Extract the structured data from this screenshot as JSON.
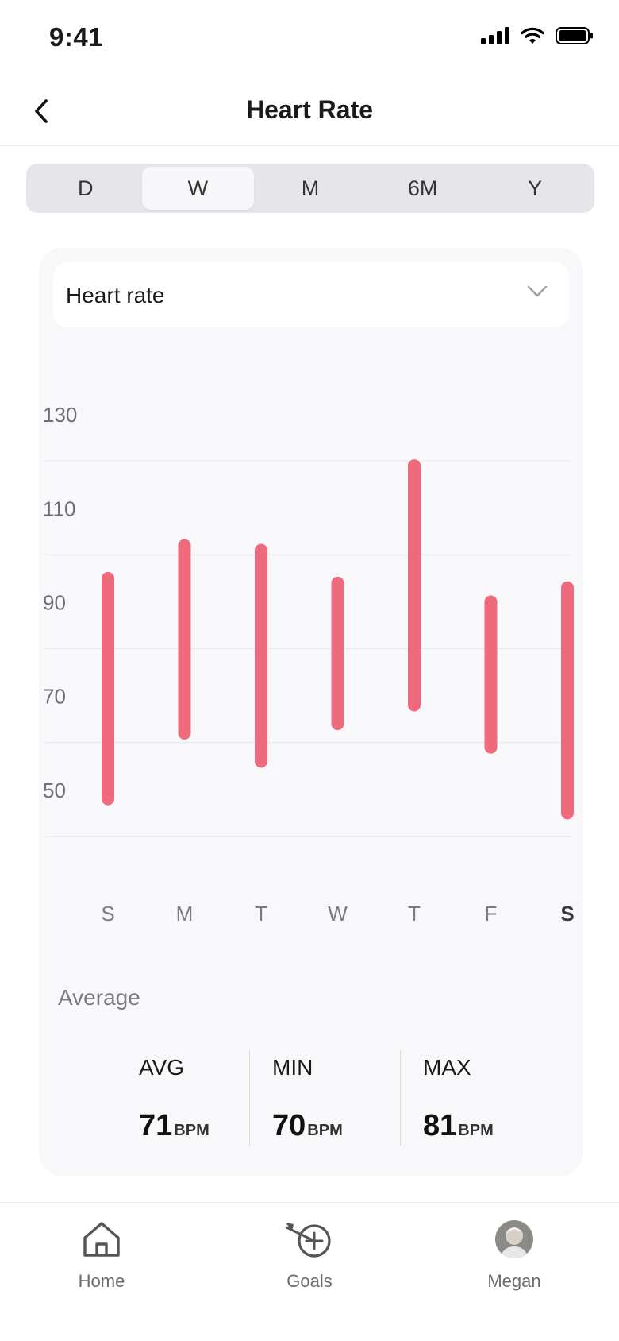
{
  "status_bar": {
    "time": "9:41"
  },
  "nav": {
    "title": "Heart Rate"
  },
  "segments": [
    {
      "label": "D",
      "active": false
    },
    {
      "label": "W",
      "active": true
    },
    {
      "label": "M",
      "active": false
    },
    {
      "label": "6M",
      "active": false
    },
    {
      "label": "Y",
      "active": false
    }
  ],
  "metric_selector": {
    "label": "Heart rate"
  },
  "chart_data": {
    "type": "bar",
    "subtype": "range",
    "categories": [
      "S",
      "M",
      "T",
      "W",
      "T",
      "F",
      "S"
    ],
    "highlighted_category_index": 6,
    "series": [
      {
        "low": [
          48,
          62,
          56,
          64,
          68,
          59,
          45
        ],
        "high": [
          95,
          102,
          101,
          94,
          119,
          90,
          93
        ]
      }
    ],
    "y_ticks": [
      50,
      70,
      90,
      110,
      130
    ],
    "ylim": [
      30,
      140
    ],
    "grid": true,
    "bar_color": "#ee6a7c"
  },
  "summary": {
    "label": "Average",
    "stats": [
      {
        "title": "AVG",
        "value": "71",
        "unit": "BPM"
      },
      {
        "title": "MIN",
        "value": "70",
        "unit": "BPM"
      },
      {
        "title": "MAX",
        "value": "81",
        "unit": "BPM"
      }
    ]
  },
  "tab_bar": {
    "items": [
      {
        "label": "Home",
        "icon": "home-icon"
      },
      {
        "label": "Goals",
        "icon": "target-icon"
      },
      {
        "label": "Megan",
        "icon": "avatar"
      }
    ]
  }
}
